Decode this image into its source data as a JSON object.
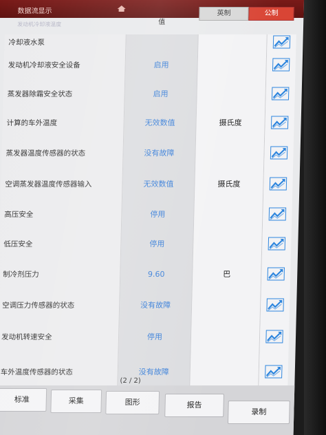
{
  "window": {
    "title": "数据流显示",
    "subtitle": "发动机冷却液温度"
  },
  "header": {
    "value_label": "值",
    "imperial_label": "英制",
    "metric_label": "公制"
  },
  "rows": [
    {
      "name": "冷却液水泵",
      "value": "",
      "unit": ""
    },
    {
      "name": "发动机冷却液安全设备",
      "value": "启用",
      "unit": ""
    },
    {
      "name": "蒸发器除霜安全状态",
      "value": "启用",
      "unit": ""
    },
    {
      "name": "计算的车外温度",
      "value": "无效数值",
      "unit": "摄氏度"
    },
    {
      "name": "蒸发器温度传感器的状态",
      "value": "没有故障",
      "unit": ""
    },
    {
      "name": "空调蒸发器温度传感器输入",
      "value": "无效数值",
      "unit": "摄氏度"
    },
    {
      "name": "高压安全",
      "value": "停用",
      "unit": ""
    },
    {
      "name": "低压安全",
      "value": "停用",
      "unit": ""
    },
    {
      "name": "制冷剂压力",
      "value": "9.60",
      "unit": "巴"
    },
    {
      "name": "空调压力传感器的状态",
      "value": "没有故障",
      "unit": ""
    },
    {
      "name": "发动机转速安全",
      "value": "停用",
      "unit": ""
    },
    {
      "name": "车外温度传感器的状态",
      "value": "没有故障",
      "unit": ""
    }
  ],
  "pagination": {
    "text": "(2 / 2)"
  },
  "footer": {
    "buttons": [
      "标准",
      "采集",
      "图形",
      "报告",
      "录制"
    ]
  },
  "icons": {
    "graph": "trend-chart-icon",
    "home": "home-icon"
  },
  "colors": {
    "title_bar": "#6b1614",
    "metric_active": "#d94535",
    "value_text": "#3b80d9",
    "graph_icon": "#2e86de"
  }
}
